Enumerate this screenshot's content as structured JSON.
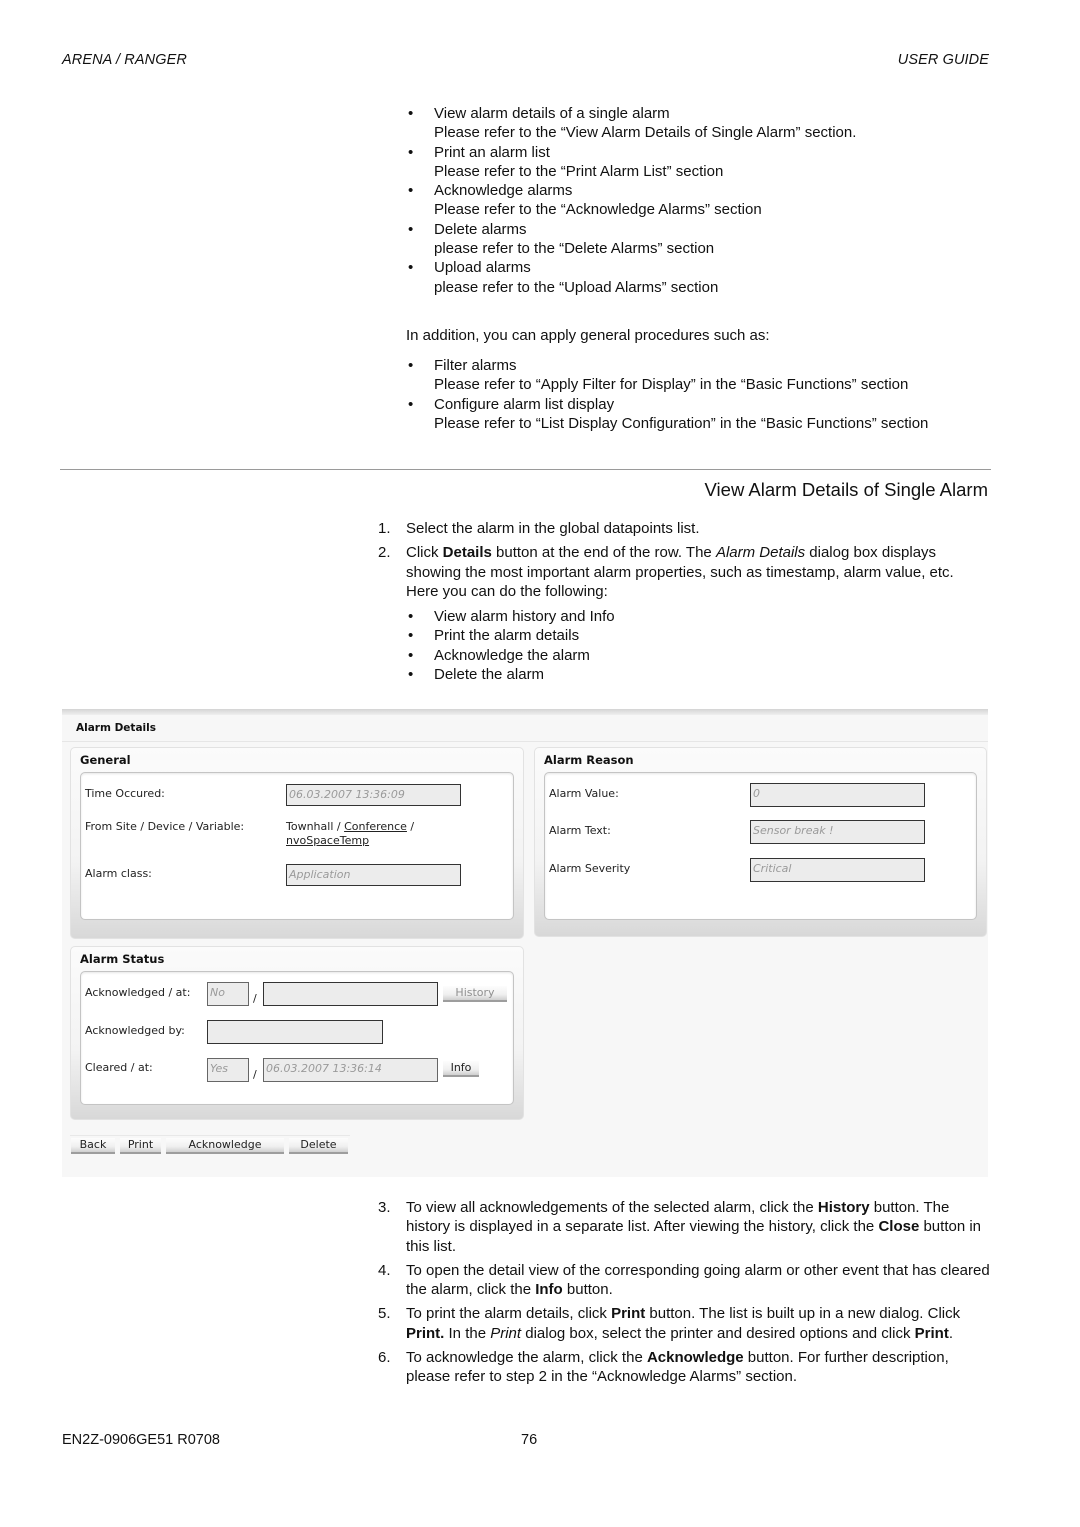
{
  "header": {
    "left": "ARENA / RANGER",
    "right": "USER GUIDE"
  },
  "intro_list": [
    {
      "item": "View alarm details of a single alarm",
      "ref": "Please refer to the “View Alarm Details of Single Alarm” section."
    },
    {
      "item": "Print an alarm list",
      "ref": "Please refer to the “Print Alarm List” section"
    },
    {
      "item": "Acknowledge alarms",
      "ref": "Please refer to the “Acknowledge Alarms” section"
    },
    {
      "item": "Delete alarms",
      "ref": "please refer to the “Delete Alarms” section"
    },
    {
      "item": "Upload alarms",
      "ref": "please refer to the “Upload Alarms” section"
    }
  ],
  "general_intro": "In addition, you can apply general procedures such as:",
  "general_list": [
    {
      "item": "Filter alarms",
      "ref": "Please refer to “Apply Filter for Display” in the “Basic Functions” section"
    },
    {
      "item": "Configure alarm list display",
      "ref": "Please refer to “List Display Configuration” in the “Basic Functions” section"
    }
  ],
  "section_title": "View Alarm Details of Single Alarm",
  "steps_before": {
    "s1": {
      "num": "1.",
      "text": "Select the alarm in the global datapoints list."
    },
    "s2": {
      "num": "2.",
      "pre": "Click ",
      "bold1": "Details",
      "mid": " button at the end of the row. The ",
      "italic1": "Alarm Details",
      "post": " dialog box displays showing the most important alarm properties, such as timestamp, alarm value, etc. Here you can do the following:",
      "bullets": [
        "View alarm history and Info",
        "Print the alarm details",
        "Acknowledge the alarm",
        "Delete the alarm"
      ]
    }
  },
  "dialog": {
    "title": "Alarm Details",
    "general": {
      "title": "General",
      "time_label": "Time Occured:",
      "time_value": "06.03.2007 13:36:09",
      "source_label": "From Site / Device / Variable:",
      "source_site": "Townhall",
      "source_device": "Conference",
      "source_variable": "nvoSpaceTemp",
      "sep": " / ",
      "class_label": "Alarm class:",
      "class_value": "Application"
    },
    "reason": {
      "title": "Alarm Reason",
      "value_label": "Alarm Value:",
      "value_value": "0",
      "text_label": "Alarm Text:",
      "text_value": "Sensor break !",
      "severity_label": "Alarm Severity",
      "severity_value": "Critical"
    },
    "status": {
      "title": "Alarm Status",
      "ack_label": "Acknowledged / at:",
      "ack_value": "No",
      "ack_at_value": "",
      "history_button": "History",
      "ackby_label": "Acknowledged by:",
      "ackby_value": "",
      "cleared_label": "Cleared / at:",
      "cleared_value": "Yes",
      "cleared_at_value": "06.03.2007 13:36:14",
      "info_button": "Info",
      "slash": "/"
    },
    "buttons": {
      "back": "Back",
      "print": "Print",
      "acknowledge": "Acknowledge",
      "delete": "Delete"
    }
  },
  "steps_after": {
    "s3": {
      "num": "3.",
      "pre": "To view all acknowledgements of the selected alarm, click the ",
      "b1": "History",
      "mid": " button. The history is displayed in a separate list. After viewing the history, click the ",
      "b2": "Close",
      "post": " button in this list."
    },
    "s4": {
      "num": "4.",
      "pre": "To open the detail view of the corresponding going alarm or other event that has cleared the alarm, click the ",
      "b1": "Info",
      "post": " button."
    },
    "s5": {
      "num": "5.",
      "pre": "To print the alarm details, click ",
      "b1": "Print",
      "mid": " button. The list is built up in a new dialog. Click ",
      "b2": "Print.",
      "mid2": " In the ",
      "i1": "Print",
      "mid3": " dialog box, select the printer and desired options and click ",
      "b3": "Print",
      "post": "."
    },
    "s6": {
      "num": "6.",
      "pre": "To acknowledge the alarm, click the ",
      "b1": "Acknowledge",
      "post": " button. For further description, please refer to step 2 in the “Acknowledge Alarms” section."
    }
  },
  "footer": {
    "doc_id": "EN2Z-0906GE51 R0708",
    "page": "76"
  },
  "glyphs": {
    "bullet": "•"
  }
}
